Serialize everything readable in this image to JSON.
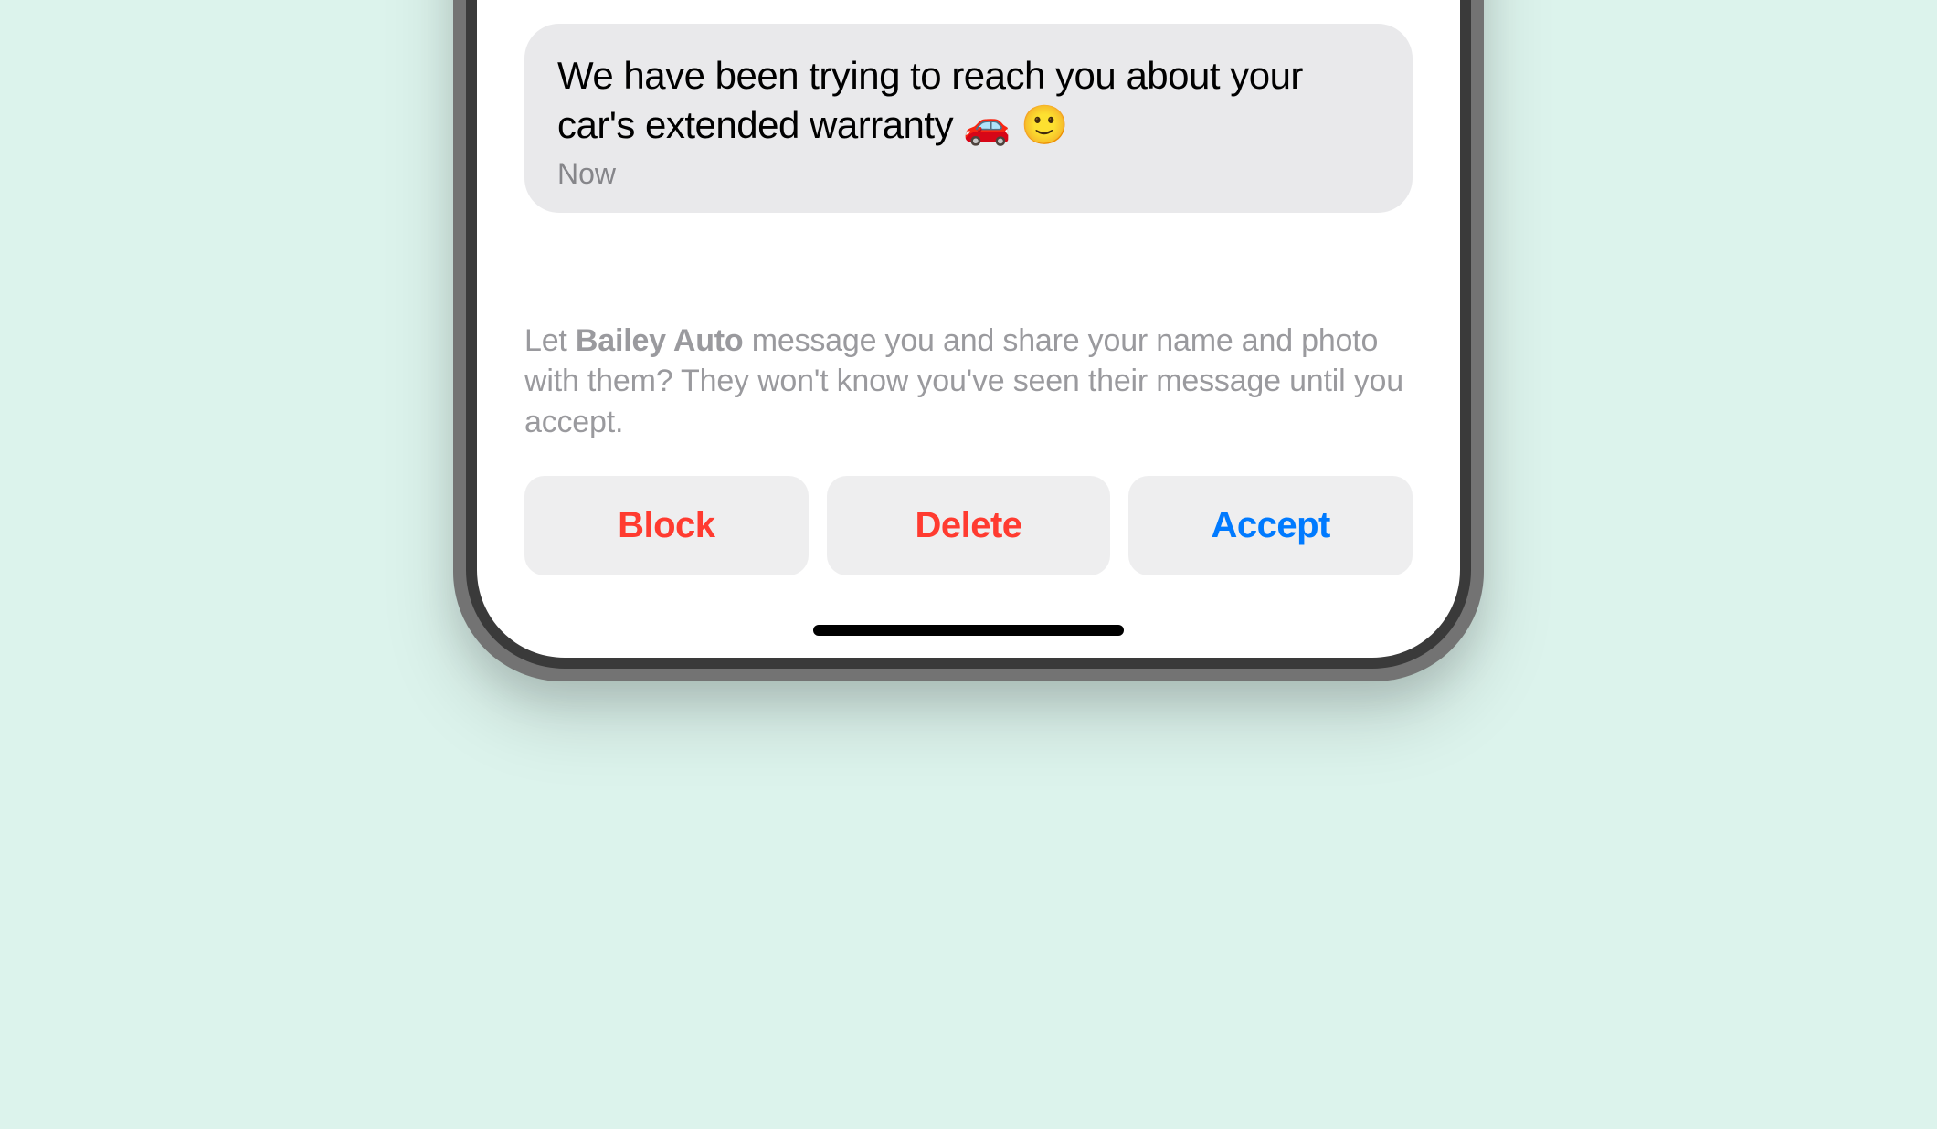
{
  "message": {
    "text": "We have been trying to reach you about your car's extended warranty 🚗 🙂",
    "timestamp": "Now"
  },
  "prompt": {
    "prefix": "Let ",
    "sender_name": "Bailey Auto",
    "suffix": " message you and share your name and photo with them? They won't know you've seen their message until you accept."
  },
  "buttons": {
    "block": "Block",
    "delete": "Delete",
    "accept": "Accept"
  }
}
